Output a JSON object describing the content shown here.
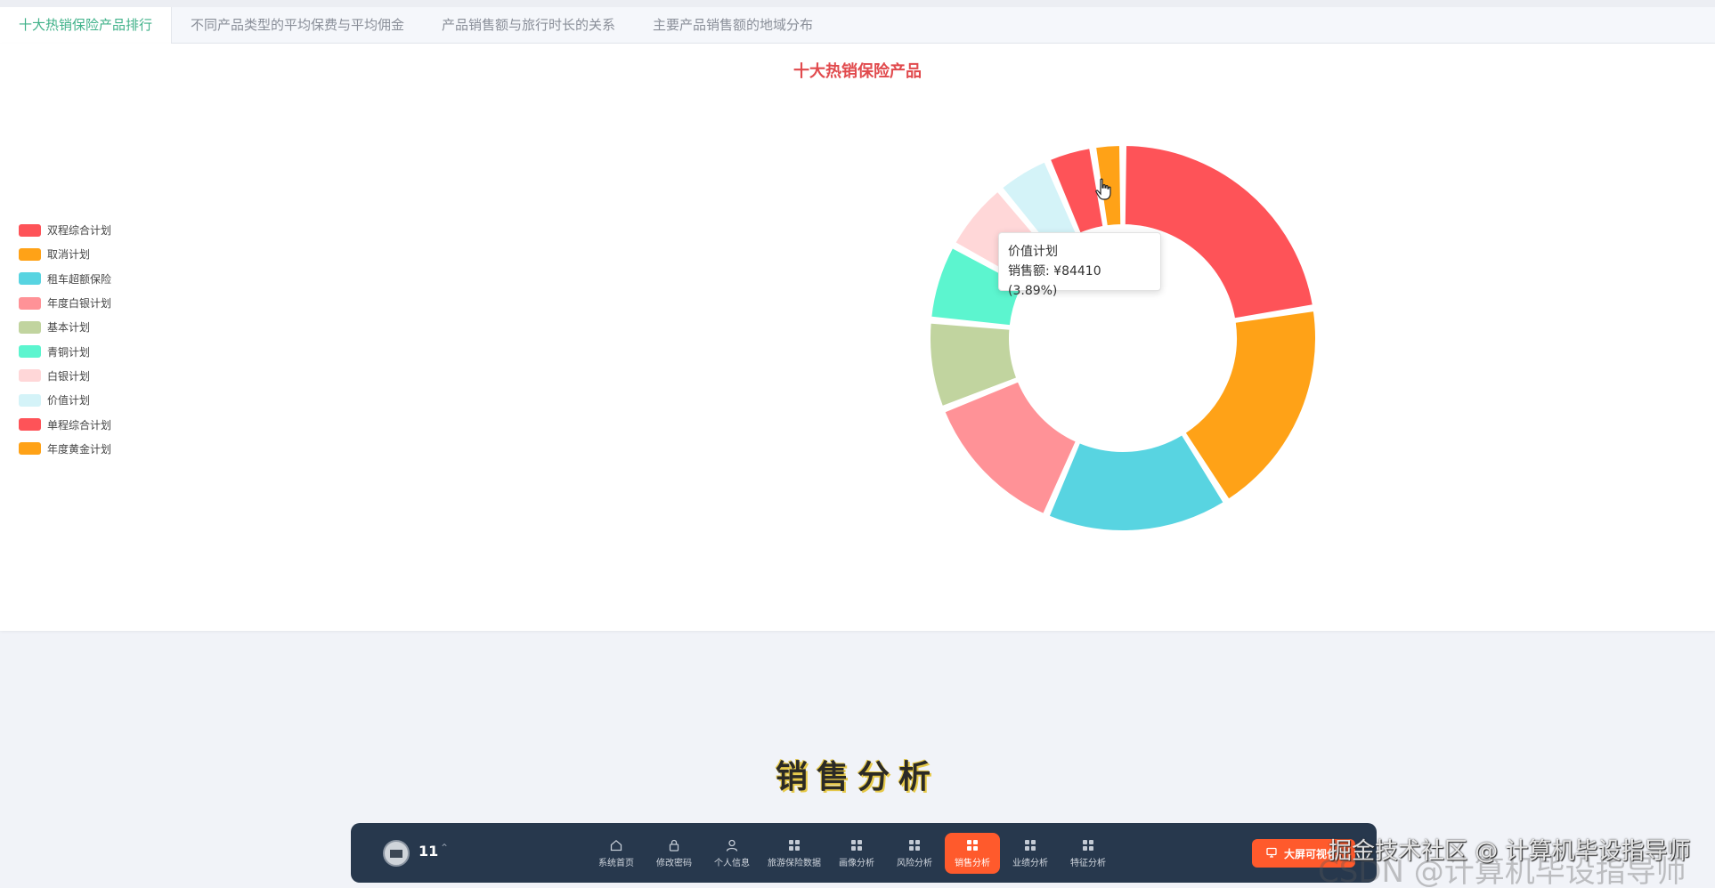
{
  "tabs": [
    {
      "label": "十大热销保险产品排行",
      "active": true
    },
    {
      "label": "不同产品类型的平均保费与平均佣金",
      "active": false
    },
    {
      "label": "产品销售额与旅行时长的关系",
      "active": false
    },
    {
      "label": "主要产品销售额的地域分布",
      "active": false
    }
  ],
  "chart_data": {
    "type": "pie",
    "title": "十大热销保险产品",
    "legend_position": "left",
    "slices": [
      {
        "name": "双程综合计划",
        "percent": 22.5,
        "color": "#fe5358"
      },
      {
        "name": "取消计划",
        "percent": 18.5,
        "color": "#ffa217"
      },
      {
        "name": "租车超额保险",
        "percent": 15.5,
        "color": "#58d4e1"
      },
      {
        "name": "年度白银计划",
        "percent": 12.5,
        "color": "#ff9297"
      },
      {
        "name": "基本计划",
        "percent": 7.5,
        "color": "#c1d49f"
      },
      {
        "name": "青铜计划",
        "percent": 6.5,
        "color": "#5cf5cf"
      },
      {
        "name": "白银计划",
        "percent": 6.0,
        "color": "#ffd7d8"
      },
      {
        "name": "价值计划",
        "percent": 4.6,
        "color": "#d4f3f8"
      },
      {
        "name": "单程综合计划",
        "percent": 3.9,
        "color": "#fe5358"
      },
      {
        "name": "年度黄金计划",
        "percent": 2.5,
        "color": "#ffa217"
      }
    ]
  },
  "tooltip": {
    "title": "价值计划",
    "line": "销售额: ¥84410 (3.89%)"
  },
  "caption": "销售分析",
  "dock": {
    "username": "11",
    "caret": "^",
    "nav": [
      {
        "label": "系统首页",
        "icon": "home-icon",
        "active": false
      },
      {
        "label": "修改密码",
        "icon": "lock-icon",
        "active": false
      },
      {
        "label": "个人信息",
        "icon": "user-icon",
        "active": false
      },
      {
        "label": "旅游保险数据",
        "icon": "grid-icon",
        "active": false
      },
      {
        "label": "画像分析",
        "icon": "grid-icon",
        "active": false
      },
      {
        "label": "风险分析",
        "icon": "grid-icon",
        "active": false
      },
      {
        "label": "销售分析",
        "icon": "grid-icon",
        "active": true
      },
      {
        "label": "业绩分析",
        "icon": "grid-icon",
        "active": false
      },
      {
        "label": "特征分析",
        "icon": "grid-icon",
        "active": false
      }
    ],
    "bigscreen_label": "大屏可视化",
    "bigscreen_icon": "monitor-icon"
  },
  "watermark": "掘金技术社区 @ 计算机毕设指导师",
  "watermark_ghost": "CSDN @计算机毕设指导师"
}
